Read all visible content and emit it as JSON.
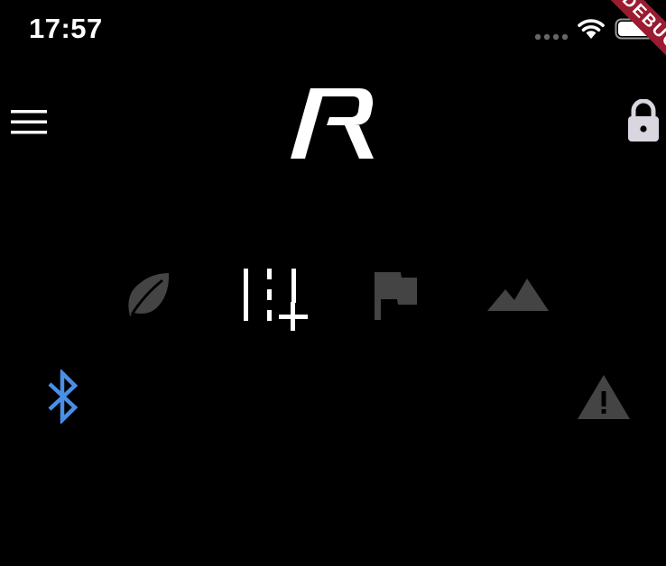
{
  "status_bar": {
    "time": "17:57",
    "icons": [
      "signal-dots-icon",
      "wifi-icon",
      "battery-icon"
    ]
  },
  "debug_banner": {
    "label": "DEBUG"
  },
  "header": {
    "menu_icon": "hamburger-menu-icon",
    "logo_icon": "r-logo-icon",
    "lock_icon": "lock-icon"
  },
  "mode_icons": [
    {
      "name": "leaf-icon",
      "active": false
    },
    {
      "name": "lane-add-icon",
      "active": true
    },
    {
      "name": "flag-icon",
      "active": false
    },
    {
      "name": "mountain-icon",
      "active": false
    }
  ],
  "indicators": {
    "bluetooth_icon": "bluetooth-icon",
    "warning_icon": "warning-icon"
  },
  "colors": {
    "background": "#000000",
    "foreground": "#ffffff",
    "inactive": "#444444",
    "bluetooth": "#4a8fe7",
    "lock": "#d9d6e0",
    "debug_banner": "#9b1b30"
  }
}
